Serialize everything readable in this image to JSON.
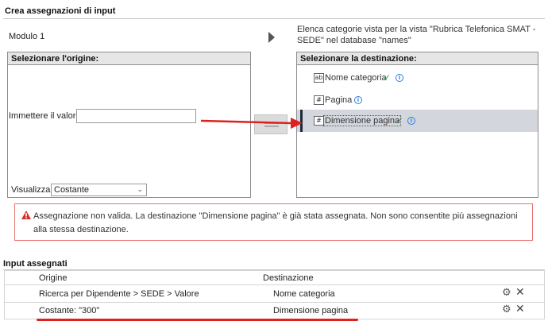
{
  "create_title": "Crea assegnazioni di input",
  "module_label": "Modulo 1",
  "list_description": "Elenca categorie vista per la vista \"Rubrica Telefonica SMAT - SEDE\" nel database \"names\"",
  "source_panel": {
    "header": "Selezionare l'origine:",
    "value_label": "Immettere il valore:",
    "value_input": "",
    "view_label": "Visualizza:",
    "view_selected": "Costante"
  },
  "dest_panel": {
    "header": "Selezionare la destinazione:",
    "items": [
      {
        "icon": "ab",
        "label": "Nome categoria",
        "checked": true
      },
      {
        "icon": "#",
        "label": "Pagina",
        "checked": false
      },
      {
        "icon": "#",
        "label": "Dimensione pagina",
        "checked": true
      }
    ]
  },
  "error_message": "Assegnazione non valida. La destinazione \"Dimensione pagina\" è già stata assegnata. Non sono consentite più assegnazioni alla stessa destinazione.",
  "assigned_title": "Input assegnati",
  "table": {
    "col_origin": "Origine",
    "col_dest": "Destinazione",
    "rows": [
      {
        "origin": "Ricerca per Dipendente > SEDE > Valore",
        "dest": "Nome categoria"
      },
      {
        "origin": "Costante: \"300\"",
        "dest": "Dimensione pagina"
      }
    ]
  },
  "colors": {
    "error_border": "#e57373",
    "error_icon": "#d32f2f",
    "accent_blue": "#2f7de1",
    "check_green": "#2e9e5b",
    "annotation_red": "#e02020"
  }
}
